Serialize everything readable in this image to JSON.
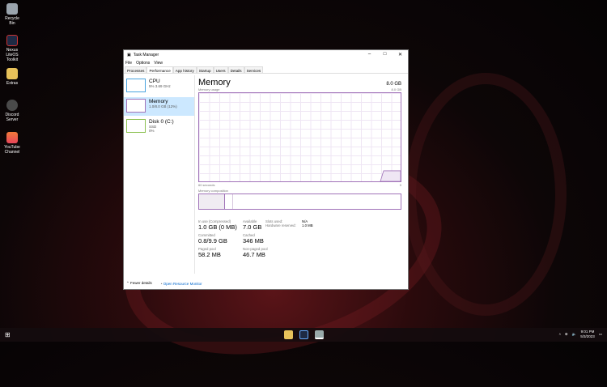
{
  "desktop": {
    "icons": [
      {
        "label": "Recycle Bin",
        "color": "#9aa4ad"
      },
      {
        "label": "Nexus LiteOS Toolkit",
        "color": "#1e2a44"
      },
      {
        "label": "Extras",
        "color": "#e8c25a"
      },
      {
        "label": "Discord Server",
        "color": "#4a4a4a"
      },
      {
        "label": "YouTube Channel",
        "color": "#e8455a"
      }
    ]
  },
  "window": {
    "title": "Task Manager",
    "menu": [
      "File",
      "Options",
      "View"
    ],
    "tabs": [
      "Processes",
      "Performance",
      "App history",
      "Startup",
      "Users",
      "Details",
      "Services"
    ],
    "active_tab": "Performance",
    "sidebar": [
      {
        "name": "CPU",
        "detail1": "5% 3.69 GHz",
        "detail2": "",
        "color": "#4aa3df"
      },
      {
        "name": "Memory",
        "detail1": "1.0/8.0 GB (12%)",
        "detail2": "",
        "color": "#a072b8"
      },
      {
        "name": "Disk 0 (C:)",
        "detail1": "SSD",
        "detail2": "0%",
        "color": "#8cc152"
      }
    ],
    "main": {
      "title": "Memory",
      "total": "8.0 GB",
      "usage_label": "Memory usage",
      "usage_max": "8.0 GB",
      "time_label": "60 seconds",
      "time_end": "0",
      "usage_percent": 12,
      "composition_label": "Memory composition",
      "stats": {
        "in_use_label": "In use (Compressed)",
        "in_use": "1.0 GB (0 MB)",
        "available_label": "Available",
        "available": "7.0 GB",
        "slots_label": "Slots used:",
        "slots": "N/A",
        "hw_label": "Hardware reserved:",
        "hw": "1.0 MB",
        "committed_label": "Committed",
        "committed": "0.8/9.9 GB",
        "cached_label": "Cached",
        "cached": "346 MB",
        "paged_label": "Paged pool",
        "paged": "58.2 MB",
        "nonpaged_label": "Non-paged pool",
        "nonpaged": "46.7 MB"
      }
    },
    "footer": {
      "fewer": "Fewer details",
      "resmon": "Open Resource Monitor"
    }
  },
  "taskbar": {
    "time": "9:01 PM",
    "date": "5/3/2023"
  }
}
